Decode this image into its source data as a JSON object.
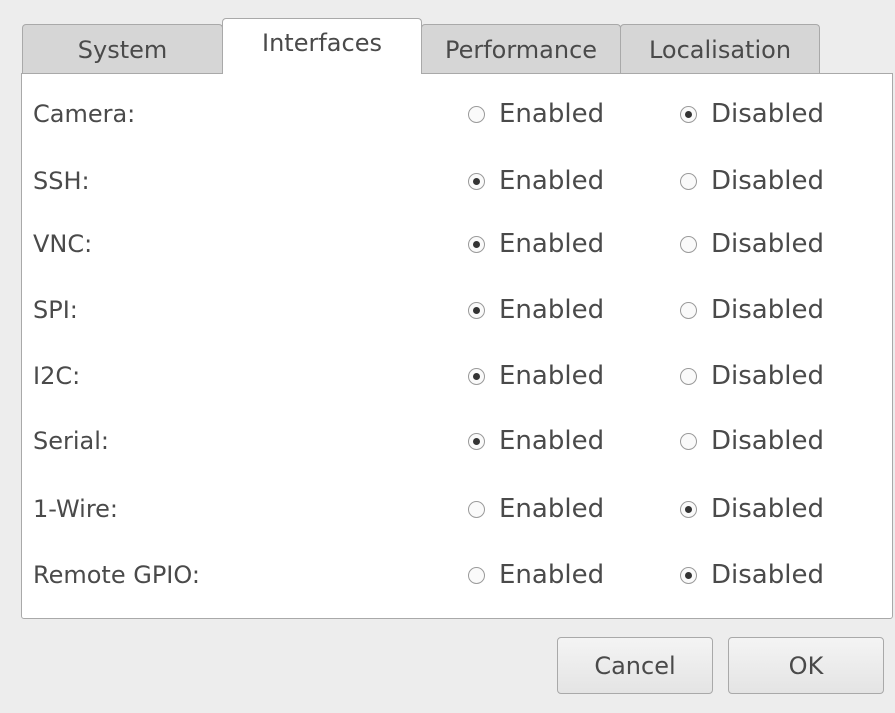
{
  "tabs": [
    {
      "label": "System",
      "active": false
    },
    {
      "label": "Interfaces",
      "active": true
    },
    {
      "label": "Performance",
      "active": false
    },
    {
      "label": "Localisation",
      "active": false
    }
  ],
  "option_labels": {
    "enabled": "Enabled",
    "disabled": "Disabled"
  },
  "interfaces": [
    {
      "label": "Camera:",
      "value": "Disabled"
    },
    {
      "label": "SSH:",
      "value": "Enabled"
    },
    {
      "label": "VNC:",
      "value": "Enabled"
    },
    {
      "label": "SPI:",
      "value": "Enabled"
    },
    {
      "label": "I2C:",
      "value": "Enabled"
    },
    {
      "label": "Serial:",
      "value": "Enabled"
    },
    {
      "label": "1-Wire:",
      "value": "Disabled"
    },
    {
      "label": "Remote GPIO:",
      "value": "Disabled"
    }
  ],
  "buttons": {
    "cancel": "Cancel",
    "ok": "OK"
  }
}
